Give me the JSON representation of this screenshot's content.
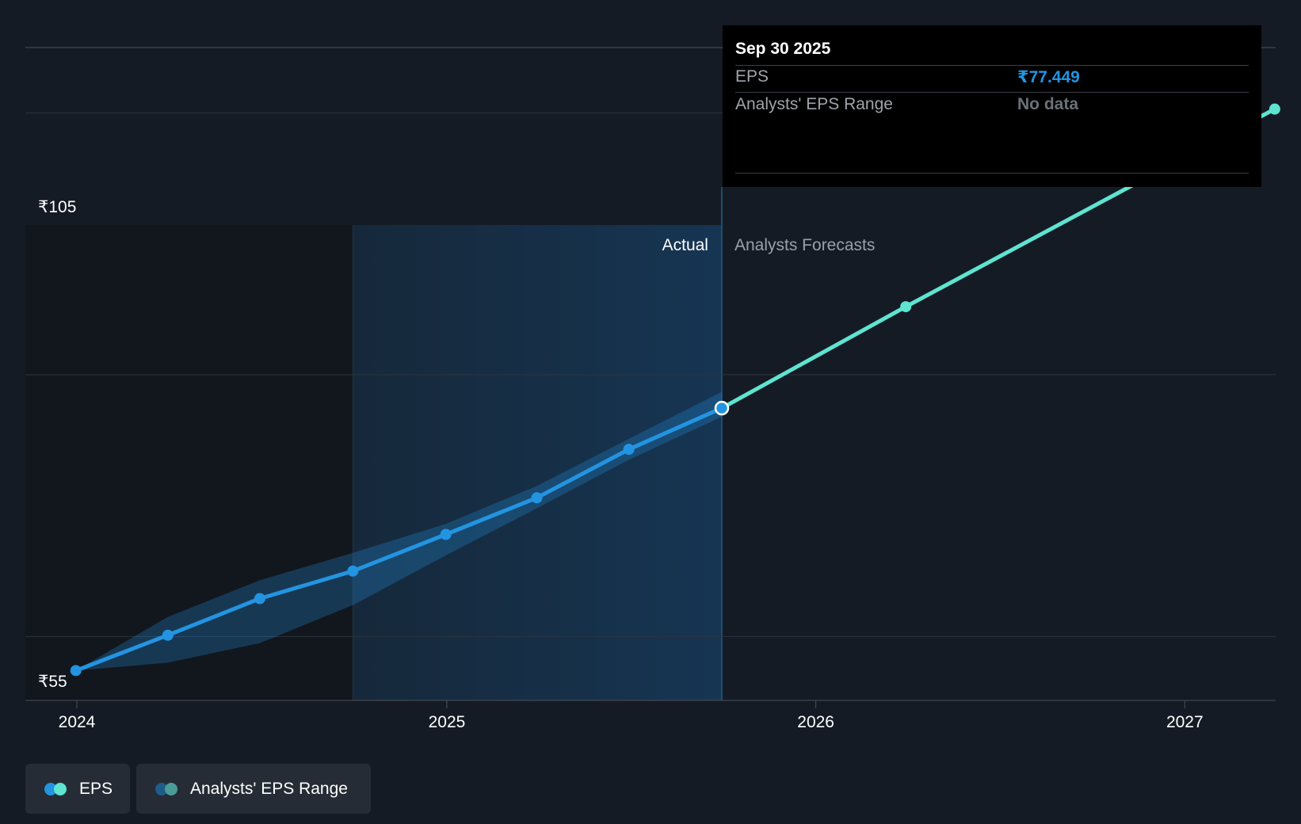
{
  "tooltip": {
    "date": "Sep 30 2025",
    "eps_label": "EPS",
    "eps_value": "₹77.449",
    "range_label": "Analysts' EPS Range",
    "range_value": "No data"
  },
  "chart_data": {
    "type": "line",
    "y_axis": {
      "min": 55,
      "max": 105,
      "labels": [
        "₹105",
        "₹55"
      ]
    },
    "x_axis": {
      "ticks": [
        "2024",
        "2025",
        "2026",
        "2027"
      ]
    },
    "section_labels": {
      "actual": "Actual",
      "forecast": "Analysts Forecasts"
    },
    "series": [
      {
        "name": "EPS",
        "segment": "actual",
        "color": "#2394e1",
        "x": [
          "2023-12-31",
          "2024-03-31",
          "2024-06-30",
          "2024-09-30",
          "2024-12-31",
          "2025-03-31",
          "2025-06-30",
          "2025-09-30"
        ],
        "y": [
          57.4,
          60.1,
          62.9,
          65.0,
          67.8,
          70.6,
          74.3,
          77.449
        ]
      },
      {
        "name": "EPS",
        "segment": "forecast",
        "color": "#5ee4d1",
        "x": [
          "2025-09-30",
          "2026-03-31",
          "2027-03-31"
        ],
        "y": [
          77.449,
          85.2,
          100.3
        ]
      }
    ],
    "range_band": {
      "name": "Analysts' EPS Range",
      "color": "#2394e1",
      "x": [
        "2023-12-31",
        "2024-03-31",
        "2024-06-30",
        "2024-09-30",
        "2024-12-31",
        "2025-03-31",
        "2025-06-30",
        "2025-09-30"
      ],
      "upper": [
        57.4,
        61.5,
        64.3,
        66.4,
        68.6,
        71.5,
        75.1,
        78.7
      ],
      "lower": [
        57.4,
        58.0,
        59.5,
        62.4,
        66.2,
        69.8,
        73.5,
        76.8
      ]
    }
  },
  "legend": [
    {
      "label": "EPS",
      "colors": [
        "#2394e1",
        "#5ee4d1"
      ]
    },
    {
      "label": "Analysts' EPS Range",
      "colors": [
        "#1e5c8a",
        "#4a9c97"
      ]
    }
  ]
}
